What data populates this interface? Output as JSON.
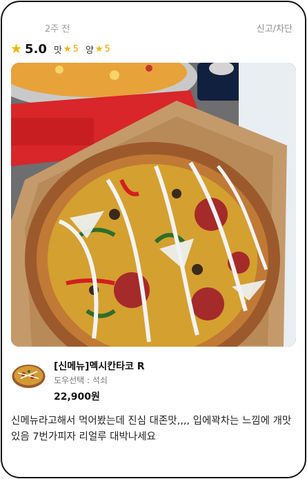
{
  "review": {
    "time_ago": "2주 전",
    "report_label": "신고/차단",
    "rating": {
      "overall": "5.0",
      "taste_label": "맛",
      "taste_value": "5",
      "quantity_label": "양",
      "quantity_value": "5"
    },
    "menu": {
      "name": "[신메뉴]멕시칸타코 R",
      "option": "도우선택 : 석쇠",
      "price": "22,900원"
    },
    "text": "신메뉴라고해서 먹어봤는데 진심 대존맛,,,, 입에꽉차는 느낌에 개맛있음 7번가피자 리얼루 대박나세요"
  },
  "icons": {
    "star": "star-icon"
  },
  "colors": {
    "star": "#f4b400",
    "meta_text": "#9b9b9b"
  }
}
